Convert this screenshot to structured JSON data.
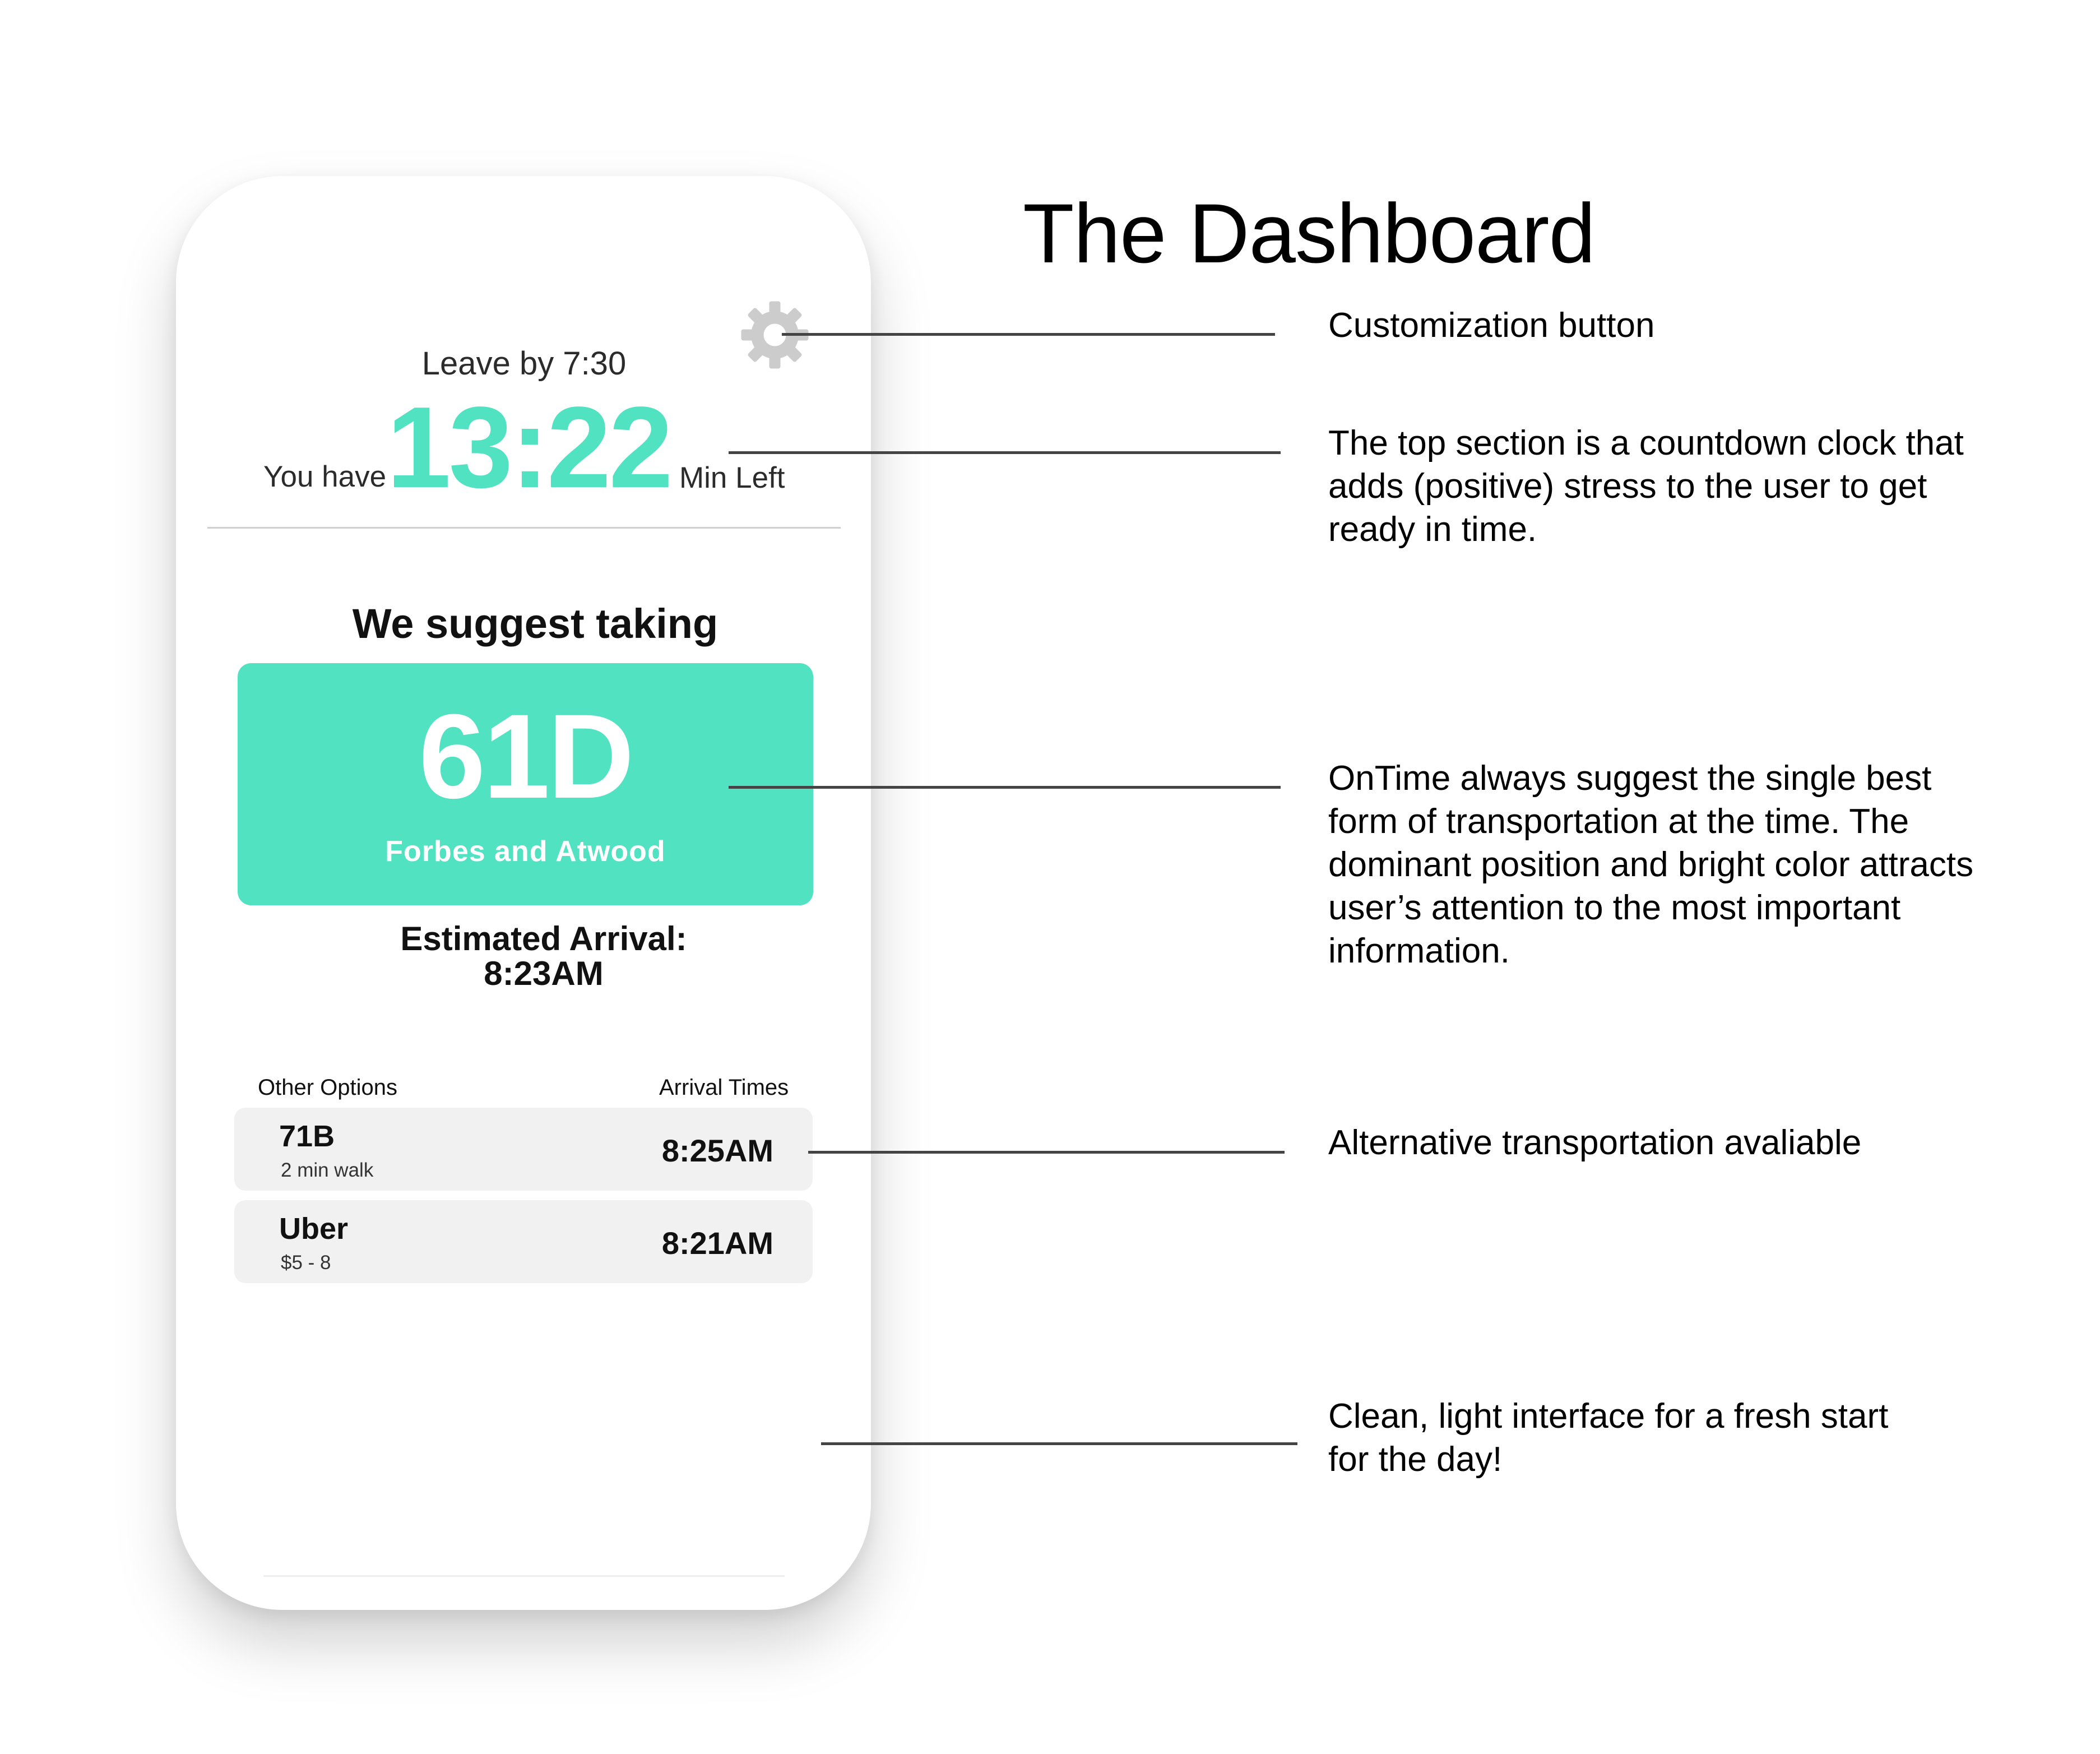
{
  "page_title": "The Dashboard",
  "phone": {
    "settings_icon": "gear-icon",
    "leave_by": "Leave by 7:30",
    "you_have": "You have",
    "countdown": "13:22",
    "min_left": "Min Left",
    "suggest_heading": "We suggest taking",
    "suggestion": {
      "route": "61D",
      "stop": "Forbes and Atwood"
    },
    "eta_label": "Estimated Arrival:",
    "eta_time": "8:23AM",
    "other_options_header": "Other Options",
    "arrival_times_header": "Arrival Times",
    "options": [
      {
        "name": "71B",
        "detail": "2 min walk",
        "arrival": "8:25AM"
      },
      {
        "name": "Uber",
        "detail": "$5 - 8",
        "arrival": "8:21AM"
      }
    ]
  },
  "annotations": {
    "customization": "Customization button",
    "countdown": "The top section is a countdown clock that adds (positive) stress to the user to get ready in time.",
    "suggestion": "OnTime always suggest the single best form of transportation at the time. The dominant position and bright color attracts user’s attention to the most important information.",
    "alternatives": "Alternative transportation avaliable",
    "clean": "Clean, light interface for a fresh start for the day!"
  },
  "colors": {
    "accent": "#51e2c1",
    "gear": "#cccccc",
    "row_background": "#f1f1f1",
    "leader_line": "#444444"
  }
}
